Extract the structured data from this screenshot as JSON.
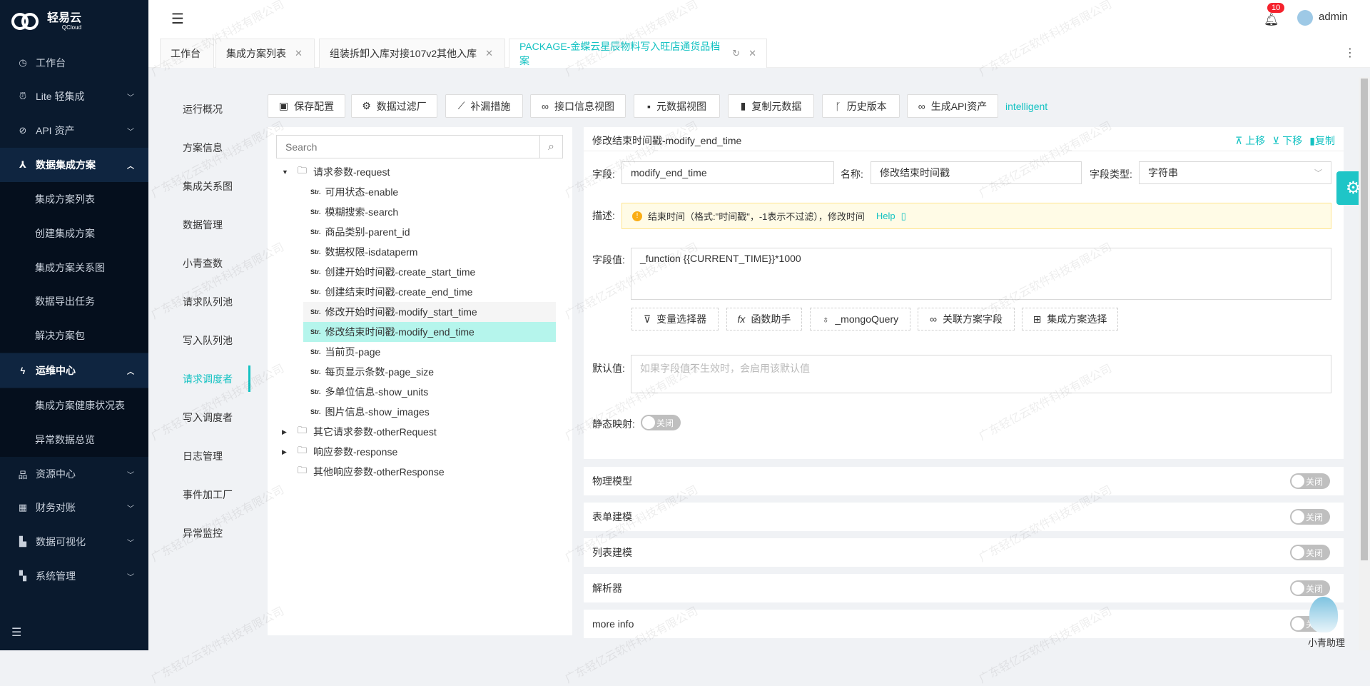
{
  "brand": {
    "name": "轻易云",
    "sub": "QCloud"
  },
  "sidebar": {
    "items": [
      {
        "label": "工作台",
        "icon": "clock-icon",
        "type": "top"
      },
      {
        "label": "Lite 轻集成",
        "icon": "alarm-icon",
        "type": "group"
      },
      {
        "label": "API 资产",
        "icon": "compass-icon",
        "type": "group"
      },
      {
        "label": "数据集成方案",
        "icon": "network-icon",
        "type": "open"
      },
      {
        "label": "集成方案列表",
        "type": "sub"
      },
      {
        "label": "创建集成方案",
        "type": "sub"
      },
      {
        "label": "集成方案关系图",
        "type": "sub"
      },
      {
        "label": "数据导出任务",
        "type": "sub"
      },
      {
        "label": "解决方案包",
        "type": "sub"
      },
      {
        "label": "运维中心",
        "icon": "bolt-icon",
        "type": "open"
      },
      {
        "label": "集成方案健康状况表",
        "type": "sub"
      },
      {
        "label": "异常数据总览",
        "type": "sub"
      },
      {
        "label": "资源中心",
        "icon": "sitemap-icon",
        "type": "group"
      },
      {
        "label": "财务对账",
        "icon": "calculator-icon",
        "type": "group"
      },
      {
        "label": "数据可视化",
        "icon": "area-chart-icon",
        "type": "group"
      },
      {
        "label": "系统管理",
        "icon": "apps-icon",
        "type": "group"
      }
    ]
  },
  "header": {
    "notifications": "10",
    "user": "admin"
  },
  "tabs": [
    {
      "label": "工作台",
      "closable": false
    },
    {
      "label": "集成方案列表",
      "closable": true
    },
    {
      "label": "组装拆卸入库对接107v2其他入库",
      "closable": true
    },
    {
      "label": "PACKAGE-金蝶云星辰物料写入旺店通货品档案",
      "closable": true,
      "active": true
    }
  ],
  "subnav": [
    "运行概况",
    "方案信息",
    "集成关系图",
    "数据管理",
    "小青查数",
    "请求队列池",
    "写入队列池",
    "请求调度者",
    "写入调度者",
    "日志管理",
    "事件加工厂",
    "异常监控"
  ],
  "subnav_active": "请求调度者",
  "toolbar": [
    {
      "label": "保存配置",
      "icon": "save-icon",
      "glyph": "▣"
    },
    {
      "label": "数据过滤厂",
      "icon": "gear-icon",
      "glyph": "⚙"
    },
    {
      "label": "补漏措施",
      "icon": "line-chart-icon",
      "glyph": "⟋"
    },
    {
      "label": "接口信息视图",
      "icon": "link-icon",
      "glyph": "∞"
    },
    {
      "label": "元数据视图",
      "icon": "terminal-icon",
      "glyph": "▪"
    },
    {
      "label": "复制元数据",
      "icon": "copy-icon",
      "glyph": "▮"
    },
    {
      "label": "历史版本",
      "icon": "branch-icon",
      "glyph": "ᚴ"
    },
    {
      "label": "生成API资产",
      "icon": "link-icon",
      "glyph": "∞"
    }
  ],
  "toolbar_link": "intelligent",
  "tree": {
    "search_placeholder": "Search",
    "rows": [
      {
        "label": "请求参数-request",
        "kind": "folder",
        "expanded": true
      },
      {
        "label": "可用状态-enable",
        "kind": "str"
      },
      {
        "label": "模糊搜索-search",
        "kind": "str"
      },
      {
        "label": "商品类别-parent_id",
        "kind": "str"
      },
      {
        "label": "数据权限-isdataperm",
        "kind": "str"
      },
      {
        "label": "创建开始时间戳-create_start_time",
        "kind": "str"
      },
      {
        "label": "创建结束时间戳-create_end_time",
        "kind": "str"
      },
      {
        "label": "修改开始时间戳-modify_start_time",
        "kind": "str",
        "state": "hover"
      },
      {
        "label": "修改结束时间戳-modify_end_time",
        "kind": "str",
        "state": "selected"
      },
      {
        "label": "当前页-page",
        "kind": "str"
      },
      {
        "label": "每页显示条数-page_size",
        "kind": "str"
      },
      {
        "label": "多单位信息-show_units",
        "kind": "str"
      },
      {
        "label": "图片信息-show_images",
        "kind": "str"
      },
      {
        "label": "其它请求参数-otherRequest",
        "kind": "folder",
        "expanded": false
      },
      {
        "label": "响应参数-response",
        "kind": "folder",
        "expanded": false
      },
      {
        "label": "其他响应参数-otherResponse",
        "kind": "folder",
        "leaf": true
      }
    ],
    "str_badge": "Str."
  },
  "detail": {
    "title": "修改结束时间戳-modify_end_time",
    "actions": {
      "up": "上移",
      "down": "下移",
      "copy": "复制"
    },
    "field_label": "字段:",
    "field_value": "modify_end_time",
    "name_label": "名称:",
    "name_value": "修改结束时间戳",
    "type_label": "字段类型:",
    "type_value": "字符串",
    "desc_label": "描述:",
    "desc_text": "结束时间（格式:\"时间戳\"，-1表示不过滤），修改时间",
    "help": "Help",
    "value_label": "字段值:",
    "value_text": "_function {{CURRENT_TIME}}*1000",
    "helpers": [
      {
        "label": "变量选择器",
        "icon": "filter-icon",
        "glyph": "⊽"
      },
      {
        "label": "函数助手",
        "icon": "function-icon",
        "glyph": "fx"
      },
      {
        "label": "_mongoQuery",
        "icon": "bulb-icon",
        "glyph": "♁"
      },
      {
        "label": "关联方案字段",
        "icon": "link-icon",
        "glyph": "∞"
      },
      {
        "label": "集成方案选择",
        "icon": "blocks-icon",
        "glyph": "⊞"
      }
    ],
    "default_label": "默认值:",
    "default_placeholder": "如果字段值不生效时，会启用该默认值",
    "static_label": "静态映射:",
    "static_toggle": "关闭"
  },
  "sections": [
    {
      "label": "物理模型",
      "toggle": "关闭"
    },
    {
      "label": "表单建模",
      "toggle": "关闭"
    },
    {
      "label": "列表建模",
      "toggle": "关闭"
    },
    {
      "label": "解析器",
      "toggle": "关闭"
    },
    {
      "label": "more info",
      "toggle": "关闭"
    }
  ],
  "assistant": "小青助理",
  "watermark": "广东轻亿云软件科技有限公司",
  "colors": {
    "accent": "#13c2c2",
    "sidebar": "#0a1a2e",
    "selected": "#b5f5ec",
    "badge": "#f5222d"
  }
}
